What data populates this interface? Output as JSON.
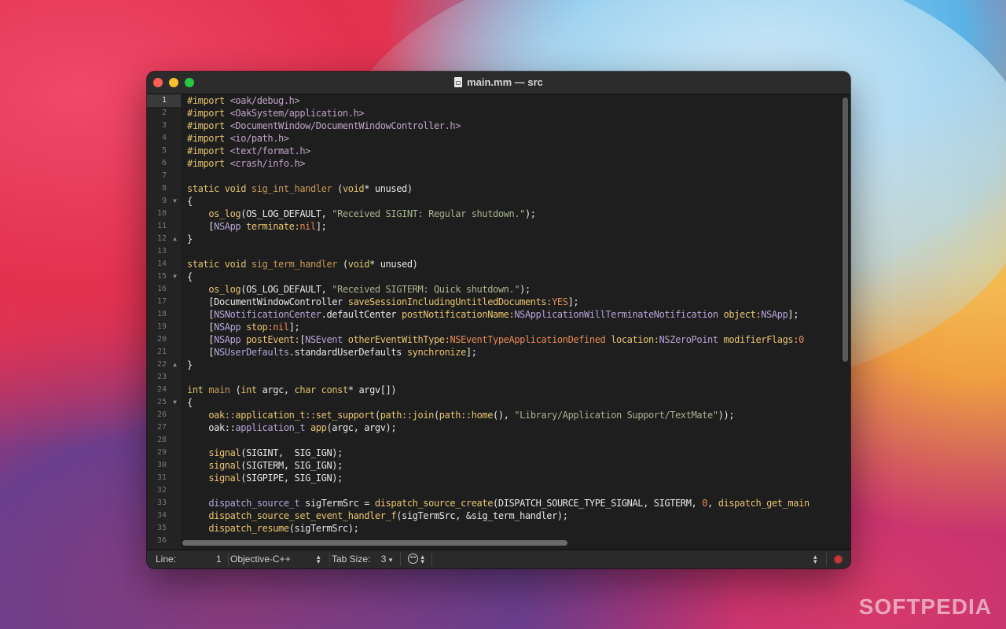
{
  "window": {
    "title": "main.mm — src",
    "file_icon": "document-icon"
  },
  "gutter": {
    "lines": [
      {
        "n": "1",
        "fold": ""
      },
      {
        "n": "2",
        "fold": ""
      },
      {
        "n": "3",
        "fold": ""
      },
      {
        "n": "4",
        "fold": ""
      },
      {
        "n": "5",
        "fold": ""
      },
      {
        "n": "6",
        "fold": ""
      },
      {
        "n": "7",
        "fold": ""
      },
      {
        "n": "8",
        "fold": ""
      },
      {
        "n": "9",
        "fold": "▼"
      },
      {
        "n": "10",
        "fold": ""
      },
      {
        "n": "11",
        "fold": ""
      },
      {
        "n": "12",
        "fold": "▲"
      },
      {
        "n": "13",
        "fold": ""
      },
      {
        "n": "14",
        "fold": ""
      },
      {
        "n": "15",
        "fold": "▼"
      },
      {
        "n": "16",
        "fold": ""
      },
      {
        "n": "17",
        "fold": ""
      },
      {
        "n": "18",
        "fold": ""
      },
      {
        "n": "19",
        "fold": ""
      },
      {
        "n": "20",
        "fold": ""
      },
      {
        "n": "21",
        "fold": ""
      },
      {
        "n": "22",
        "fold": "▲"
      },
      {
        "n": "23",
        "fold": ""
      },
      {
        "n": "24",
        "fold": ""
      },
      {
        "n": "25",
        "fold": "▼"
      },
      {
        "n": "26",
        "fold": ""
      },
      {
        "n": "27",
        "fold": ""
      },
      {
        "n": "28",
        "fold": ""
      },
      {
        "n": "29",
        "fold": ""
      },
      {
        "n": "30",
        "fold": ""
      },
      {
        "n": "31",
        "fold": ""
      },
      {
        "n": "32",
        "fold": ""
      },
      {
        "n": "33",
        "fold": ""
      },
      {
        "n": "34",
        "fold": ""
      },
      {
        "n": "35",
        "fold": ""
      },
      {
        "n": "36",
        "fold": ""
      }
    ],
    "current_line": "1"
  },
  "colors": {
    "keyword": "#e0c46c",
    "function": "#c99a5b",
    "string": "#a6b38f",
    "include": "#c0a2c7",
    "constant": "#e68b54",
    "objc_class": "#b6a4d8",
    "method": "#e8c46e",
    "plain": "#e6e6e6"
  },
  "code": [
    [
      [
        "kw",
        "#import "
      ],
      [
        "inc",
        "<oak/debug.h>"
      ]
    ],
    [
      [
        "kw",
        "#import "
      ],
      [
        "inc",
        "<OakSystem/application.h>"
      ]
    ],
    [
      [
        "kw",
        "#import "
      ],
      [
        "inc",
        "<DocumentWindow/DocumentWindowController.h>"
      ]
    ],
    [
      [
        "kw",
        "#import "
      ],
      [
        "inc",
        "<io/path.h>"
      ]
    ],
    [
      [
        "kw",
        "#import "
      ],
      [
        "inc",
        "<text/format.h>"
      ]
    ],
    [
      [
        "kw",
        "#import "
      ],
      [
        "inc",
        "<crash/info.h>"
      ]
    ],
    [],
    [
      [
        "kw",
        "static void "
      ],
      [
        "fn",
        "sig_int_handler"
      ],
      [
        "p",
        " ("
      ],
      [
        "kw",
        "void"
      ],
      [
        "p",
        "* unused)"
      ]
    ],
    [
      [
        "p",
        "{"
      ]
    ],
    [
      [
        "p",
        "    "
      ],
      [
        "meth",
        "os_log"
      ],
      [
        "p",
        "(OS_LOG_DEFAULT, "
      ],
      [
        "str",
        "\"Received SIGINT: Regular shutdown.\""
      ],
      [
        "p",
        ");"
      ]
    ],
    [
      [
        "p",
        "    ["
      ],
      [
        "cls",
        "NSApp"
      ],
      [
        "p",
        " "
      ],
      [
        "meth",
        "terminate:"
      ],
      [
        "const",
        "nil"
      ],
      [
        "p",
        "];"
      ]
    ],
    [
      [
        "p",
        "}"
      ]
    ],
    [],
    [
      [
        "kw",
        "static void "
      ],
      [
        "fn",
        "sig_term_handler"
      ],
      [
        "p",
        " ("
      ],
      [
        "kw",
        "void"
      ],
      [
        "p",
        "* unused)"
      ]
    ],
    [
      [
        "p",
        "{"
      ]
    ],
    [
      [
        "p",
        "    "
      ],
      [
        "meth",
        "os_log"
      ],
      [
        "p",
        "(OS_LOG_DEFAULT, "
      ],
      [
        "str",
        "\"Received SIGTERM: Quick shutdown.\""
      ],
      [
        "p",
        ");"
      ]
    ],
    [
      [
        "p",
        "    [DocumentWindowController "
      ],
      [
        "meth",
        "saveSessionIncludingUntitledDocuments:"
      ],
      [
        "const",
        "YES"
      ],
      [
        "p",
        "];"
      ]
    ],
    [
      [
        "p",
        "    ["
      ],
      [
        "cls",
        "NSNotificationCenter"
      ],
      [
        "p",
        ".defaultCenter "
      ],
      [
        "meth",
        "postNotificationName:"
      ],
      [
        "cls",
        "NSApplicationWillTerminateNotification"
      ],
      [
        "p",
        " "
      ],
      [
        "meth",
        "object:"
      ],
      [
        "cls",
        "NSApp"
      ],
      [
        "p",
        "];"
      ]
    ],
    [
      [
        "p",
        "    ["
      ],
      [
        "cls",
        "NSApp"
      ],
      [
        "p",
        " "
      ],
      [
        "meth",
        "stop:"
      ],
      [
        "const",
        "nil"
      ],
      [
        "p",
        "];"
      ]
    ],
    [
      [
        "p",
        "    ["
      ],
      [
        "cls",
        "NSApp"
      ],
      [
        "p",
        " "
      ],
      [
        "meth",
        "postEvent:"
      ],
      [
        "p",
        "["
      ],
      [
        "cls",
        "NSEvent"
      ],
      [
        "p",
        " "
      ],
      [
        "meth",
        "otherEventWithType:"
      ],
      [
        "const",
        "NSEventTypeApplicationDefined"
      ],
      [
        "p",
        " "
      ],
      [
        "meth",
        "location:"
      ],
      [
        "cls",
        "NSZeroPoint"
      ],
      [
        "p",
        " "
      ],
      [
        "meth",
        "modifierFlags:"
      ],
      [
        "const",
        "0"
      ]
    ],
    [
      [
        "p",
        "    ["
      ],
      [
        "cls",
        "NSUserDefaults"
      ],
      [
        "p",
        ".standardUserDefaults "
      ],
      [
        "meth",
        "synchronize"
      ],
      [
        "p",
        "];"
      ]
    ],
    [
      [
        "p",
        "}"
      ]
    ],
    [],
    [
      [
        "kw",
        "int "
      ],
      [
        "fn",
        "main"
      ],
      [
        "p",
        " ("
      ],
      [
        "kw",
        "int"
      ],
      [
        "p",
        " argc, "
      ],
      [
        "kw",
        "char const"
      ],
      [
        "p",
        "* argv[])"
      ]
    ],
    [
      [
        "p",
        "{"
      ]
    ],
    [
      [
        "p",
        "    "
      ],
      [
        "meth",
        "oak::application_t::set_support"
      ],
      [
        "p",
        "("
      ],
      [
        "meth",
        "path::join"
      ],
      [
        "p",
        "("
      ],
      [
        "meth",
        "path::home"
      ],
      [
        "p",
        "(), "
      ],
      [
        "str",
        "\"Library/Application Support/TextMate\""
      ],
      [
        "p",
        "));"
      ]
    ],
    [
      [
        "p",
        "    oak::"
      ],
      [
        "cls",
        "application_t"
      ],
      [
        "p",
        " "
      ],
      [
        "meth",
        "app"
      ],
      [
        "p",
        "(argc, argv);"
      ]
    ],
    [],
    [
      [
        "p",
        "    "
      ],
      [
        "meth",
        "signal"
      ],
      [
        "p",
        "(SIGINT,  SIG_IGN);"
      ]
    ],
    [
      [
        "p",
        "    "
      ],
      [
        "meth",
        "signal"
      ],
      [
        "p",
        "(SIGTERM, SIG_IGN);"
      ]
    ],
    [
      [
        "p",
        "    "
      ],
      [
        "meth",
        "signal"
      ],
      [
        "p",
        "(SIGPIPE, SIG_IGN);"
      ]
    ],
    [],
    [
      [
        "p",
        "    "
      ],
      [
        "cls",
        "dispatch_source_t"
      ],
      [
        "p",
        " sigTermSrc = "
      ],
      [
        "meth",
        "dispatch_source_create"
      ],
      [
        "p",
        "(DISPATCH_SOURCE_TYPE_SIGNAL, SIGTERM, "
      ],
      [
        "const",
        "0"
      ],
      [
        "p",
        ", "
      ],
      [
        "meth",
        "dispatch_get_main"
      ]
    ],
    [
      [
        "p",
        "    "
      ],
      [
        "meth",
        "dispatch_source_set_event_handler_f"
      ],
      [
        "p",
        "(sigTermSrc, &sig_term_handler);"
      ]
    ],
    [
      [
        "p",
        "    "
      ],
      [
        "meth",
        "dispatch_resume"
      ],
      [
        "p",
        "(sigTermSrc);"
      ]
    ],
    []
  ],
  "statusbar": {
    "line_label": "Line:",
    "line_value": "1",
    "language": "Objective-C++",
    "tab_label": "Tab Size:",
    "tab_value": "3",
    "symbol_icon": "ellipsis-circle-icon",
    "record_icon": "record-macro-icon"
  },
  "watermark": "SOFTPEDIA"
}
